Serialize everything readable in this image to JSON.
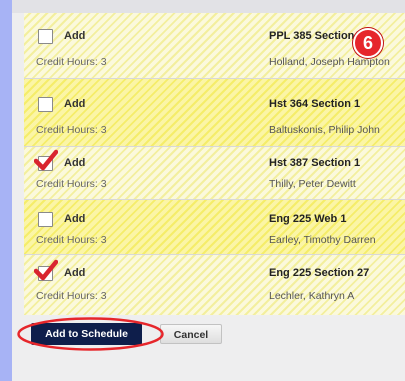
{
  "courses": [
    {
      "add_label": "Add",
      "checked": false,
      "credit": "Credit Hours: 3",
      "course": "PPL 385 Section",
      "instructor": "Holland, Joseph Hampton"
    },
    {
      "add_label": "Add",
      "checked": false,
      "credit": "Credit Hours: 3",
      "course": "Hst 364 Section 1",
      "instructor": "Baltuskonis, Philip John"
    },
    {
      "add_label": "Add",
      "checked": true,
      "credit": "Credit Hours: 3",
      "course": "Hst 387 Section 1",
      "instructor": "Thilly, Peter Dewitt"
    },
    {
      "add_label": "Add",
      "checked": false,
      "credit": "Credit Hours: 3",
      "course": "Eng 225 Web 1",
      "instructor": "Earley, Timothy Darren"
    },
    {
      "add_label": "Add",
      "checked": true,
      "credit": "Credit Hours: 3",
      "course": "Eng 225 Section 27",
      "instructor": "Lechler, Kathryn A"
    }
  ],
  "step_badge": "6",
  "buttons": {
    "add_to_schedule": "Add to Schedule",
    "cancel": "Cancel"
  },
  "colors": {
    "page_bg": "#a7b3f5",
    "row_stripe": "#f5ed6a",
    "primary_button": "#0e1e4b",
    "annotation": "#e6262b"
  }
}
